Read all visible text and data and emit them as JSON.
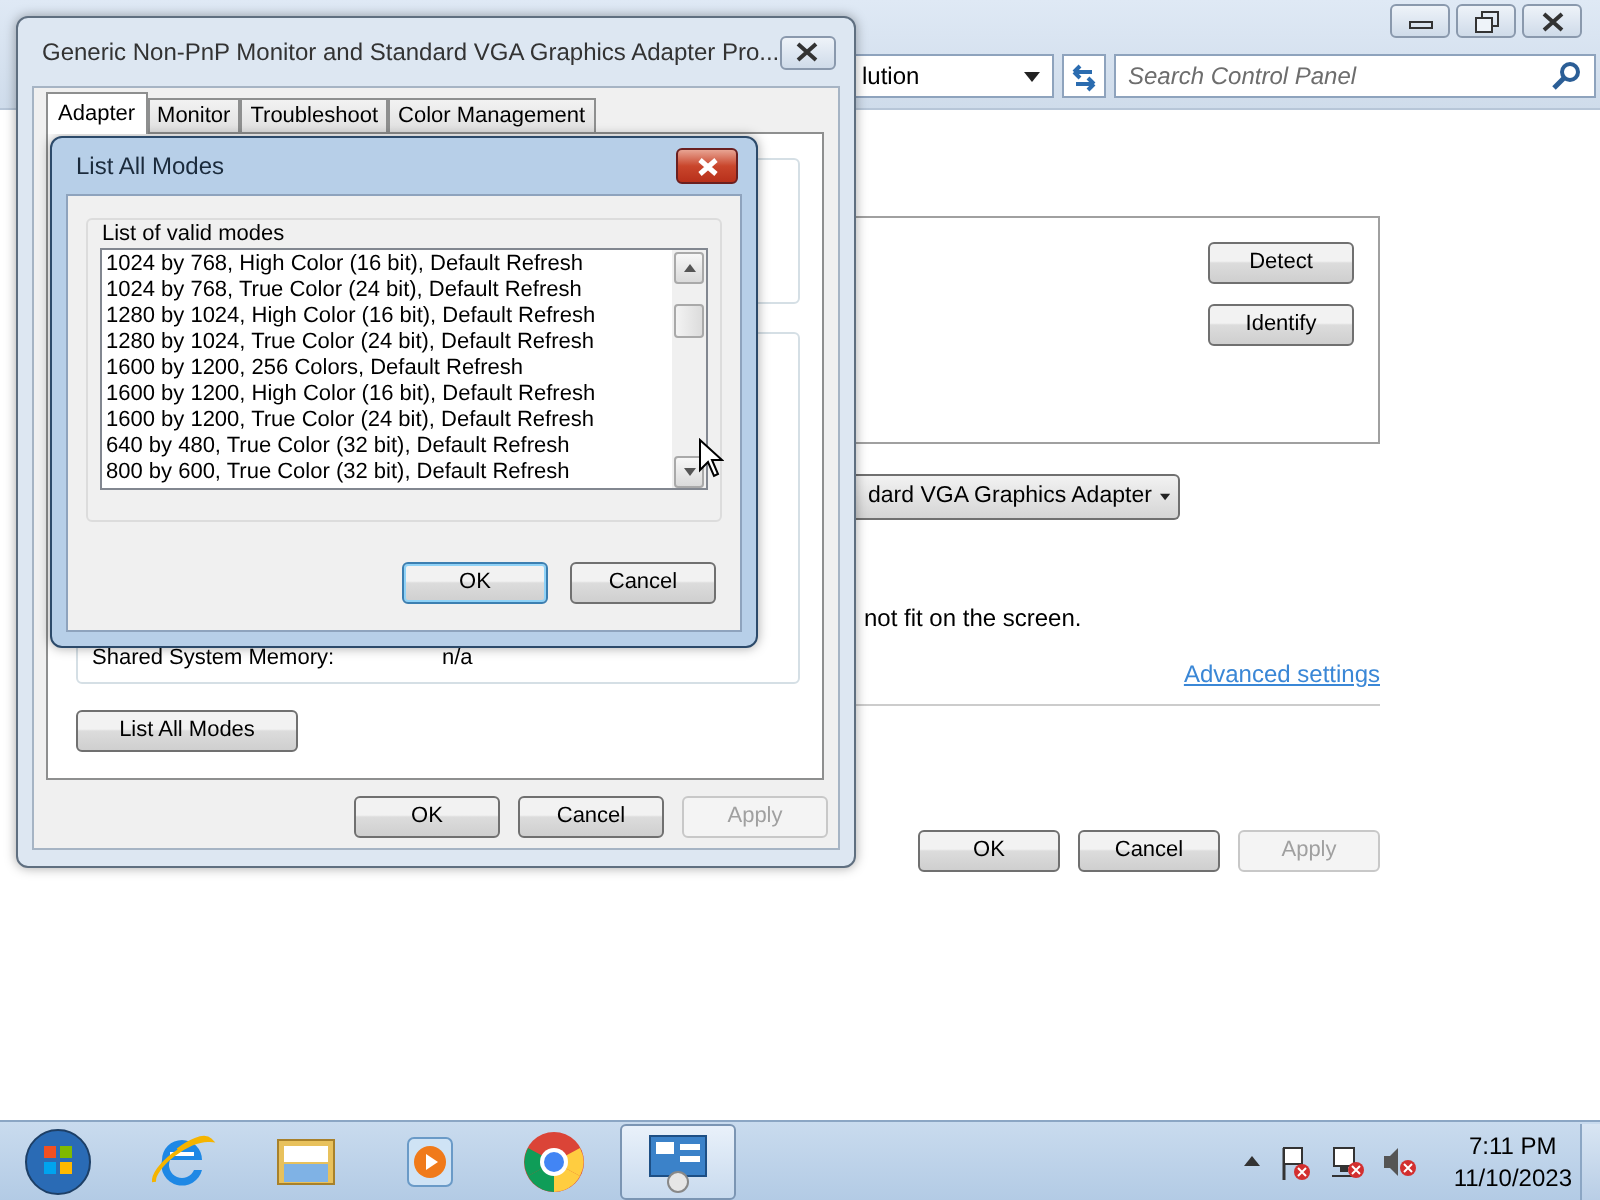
{
  "control_panel": {
    "address_text": "lution",
    "search": {
      "placeholder": "Search Control Panel"
    },
    "display_buttons": [
      "Detect",
      "Identify"
    ],
    "adapter_dropdown": "dard VGA Graphics Adapter",
    "note": "not fit on the screen.",
    "link": "Advanced settings",
    "buttons": [
      {
        "label": "OK",
        "disabled": false
      },
      {
        "label": "Cancel",
        "disabled": false
      },
      {
        "label": "Apply",
        "disabled": true
      }
    ]
  },
  "properties_dialog": {
    "title": "Generic Non-PnP Monitor and Standard VGA Graphics Adapter Pro...",
    "tabs": [
      {
        "label": "Adapter",
        "selected": true
      },
      {
        "label": "Monitor",
        "selected": false
      },
      {
        "label": "Troubleshoot",
        "selected": false
      },
      {
        "label": "Color Management",
        "selected": false
      }
    ],
    "fields": [
      {
        "label": "Shared System Memory:",
        "value": "n/a"
      }
    ],
    "list_modes_button": "List All Modes",
    "buttons": [
      {
        "label": "OK",
        "disabled": false
      },
      {
        "label": "Cancel",
        "disabled": false
      },
      {
        "label": "Apply",
        "disabled": true
      }
    ]
  },
  "modes_dialog": {
    "title": "List All Modes",
    "group_label": "List of valid modes",
    "modes": [
      "1024 by 768, High Color (16 bit), Default Refresh",
      "1024 by 768, True Color (24 bit), Default Refresh",
      "1280 by 1024, High Color (16 bit), Default Refresh",
      "1280 by 1024, True Color (24 bit), Default Refresh",
      "1600 by 1200, 256 Colors, Default Refresh",
      "1600 by 1200, High Color (16 bit), Default Refresh",
      "1600 by 1200, True Color (24 bit), Default Refresh",
      "640 by 480, True Color (32 bit), Default Refresh",
      "800 by 600, True Color (32 bit), Default Refresh"
    ],
    "buttons": [
      {
        "label": "OK",
        "default": true
      },
      {
        "label": "Cancel",
        "default": false
      }
    ]
  },
  "taskbar": {
    "apps": [
      {
        "kind": "browser",
        "active": false
      },
      {
        "kind": "folder",
        "active": false
      },
      {
        "kind": "media",
        "active": false
      },
      {
        "kind": "chrome",
        "active": false
      },
      {
        "kind": "control-panel",
        "active": true
      }
    ],
    "time": "7:11 PM",
    "date": "11/10/2023"
  }
}
